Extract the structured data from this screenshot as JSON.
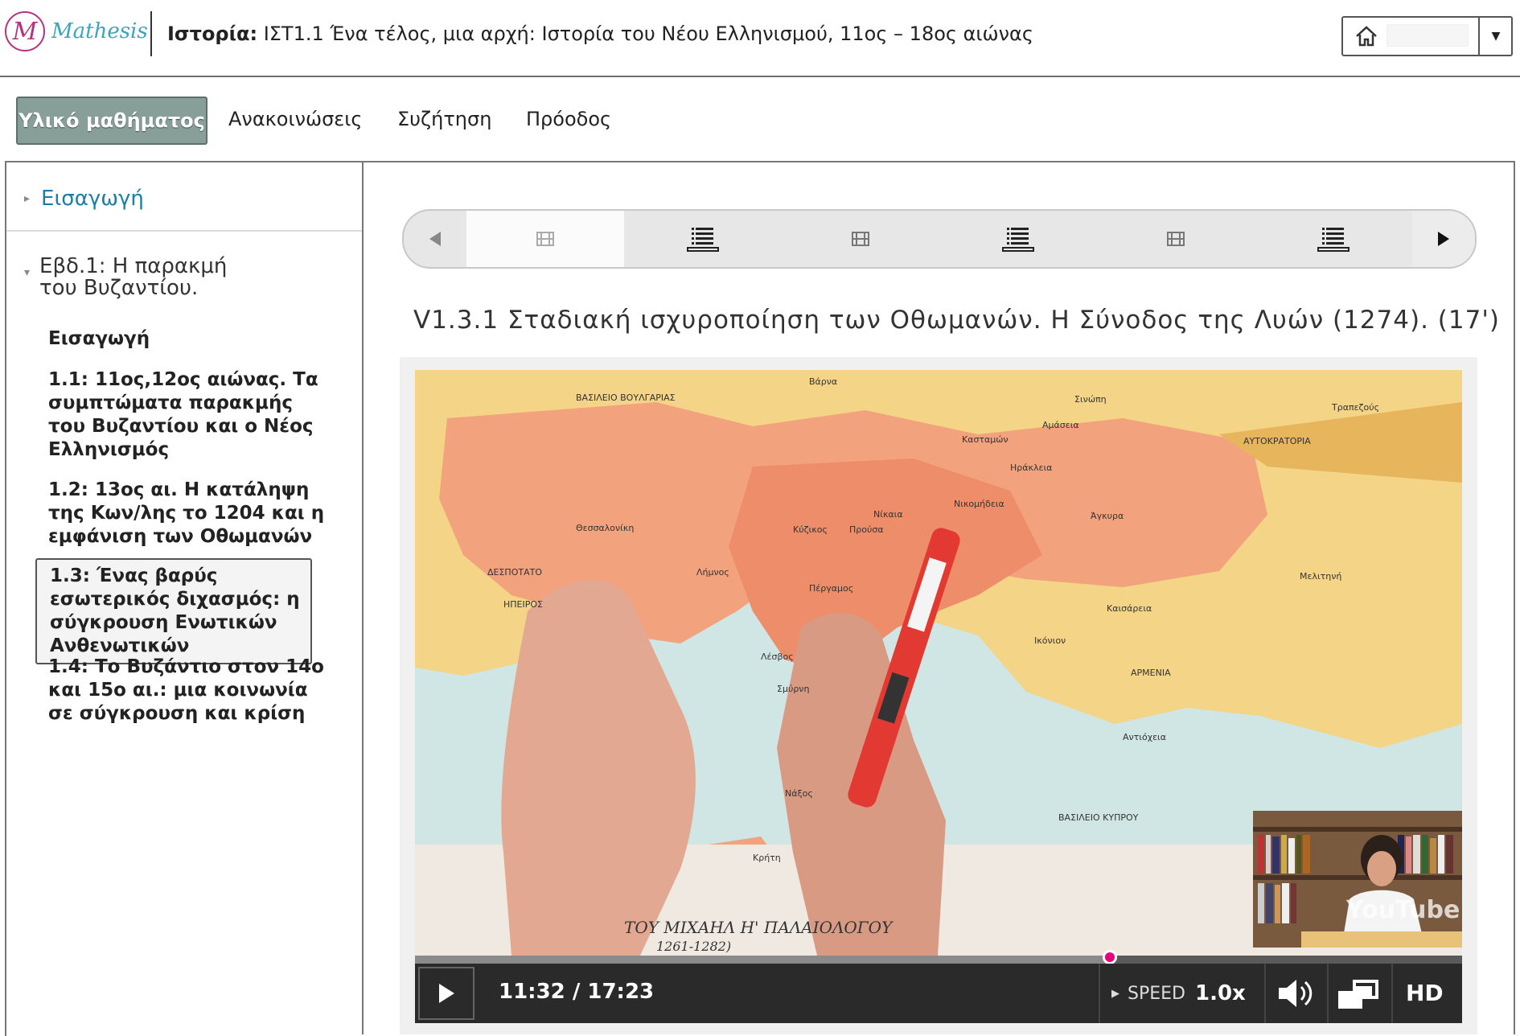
{
  "header": {
    "logo_text": "Mathesis",
    "logo_mark": "M",
    "course_label": "Ιστορία:",
    "course_title": "ΙΣΤ1.1 Ένα τέλος, μια αρχή: Ιστορία του Νέου Ελληνισμού, 11ος – 18ος αιώνας",
    "user_menu": {
      "icon": "home-icon",
      "dropdown_icon": "chevron-down-icon"
    }
  },
  "nav": {
    "items": [
      {
        "label": "Υλικό μαθήματος",
        "active": true
      },
      {
        "label": "Ανακοινώσεις"
      },
      {
        "label": "Συζήτηση"
      },
      {
        "label": "Πρόοδος"
      }
    ]
  },
  "sidebar": {
    "intro": "Εισαγωγή",
    "chapter_line1": "Εβδ.1: Η παρακμή",
    "chapter_line2": "του Βυζαντίου.",
    "subsections": [
      {
        "label": "Εισαγωγή"
      },
      {
        "label": "1.1: 11ος,12ος αιώνας. Τα συμπτώματα παρακμής του Βυζαντίου και ο Νέος Ελληνισμός"
      },
      {
        "label": "1.2: 13ος αι. Η κατάληψη της Κων/λης το 1204 και η εμφάνιση των Οθωμανών"
      },
      {
        "label": "1.3: Ένας βαρύς εσωτερικός διχασμός: η σύγκρουση Ενωτικών Ανθενωτικών",
        "active": true
      },
      {
        "label": "1.4: Το Βυζάντιο στον 14ο και 15ο αι.: μια κοινωνία σε σύγκρουση και κρίση"
      }
    ]
  },
  "sequence": {
    "tabs": [
      "video-icon",
      "list-icon",
      "video-icon",
      "list-icon",
      "video-icon",
      "list-icon"
    ],
    "active_index": 0
  },
  "video": {
    "title": "V1.3.1 Σταδιακή ισχυροποίηση των Οθωμανών. Η Σύνοδος της Λυών (1274). (17')",
    "time": "11:32 / 17:23",
    "progress": 0.6635,
    "speed_label": "SPEED",
    "speed_value": "1.0x",
    "hd_label": "HD",
    "watermark": "YouTube",
    "map_title": "ΤΟΥ ΜΙΧΑΗΛ Η' ΠΑΛΑΙΟΛΟΓΟΥ",
    "map_subtitle": "1261-1282)",
    "map_labels": [
      "ΒΑΣΙΛΕΙΟ ΒΟΥΛΓΑΡΙΑΣ",
      "Βάρνα",
      "Σινώπη",
      "Τραπεζούς",
      "ΑΥΤΟΚΡΑΤΟΡΙΑ",
      "Αμάσεια",
      "Κασταμών",
      "Ηράκλεια",
      "Νικομήδεια",
      "Νίκαια",
      "Κύζικος",
      "Προύσα",
      "Πέργαμος",
      "Άγκυρα",
      "ΔΕΣΠΟΤΑΤΟ",
      "ΗΠΕΙΡΟΣ",
      "Θεσσαλονίκη",
      "Λήμνος",
      "Λέσβος",
      "Σμύρνη",
      "Νάξος",
      "Κρήτη",
      "Ικόνιον",
      "Καισάρεια",
      "ΑΡΜΕΝΙΑ",
      "Αντιόχεια",
      "ΒΑΣΙΛΕΙΟ ΚΥΠΡΟΥ",
      "Μελιτηνή"
    ]
  },
  "colors": {
    "accent": "#1b7ea8",
    "active_nav": "#889e98",
    "logo": "#b5327e",
    "progress_knob": "#e6007e"
  }
}
